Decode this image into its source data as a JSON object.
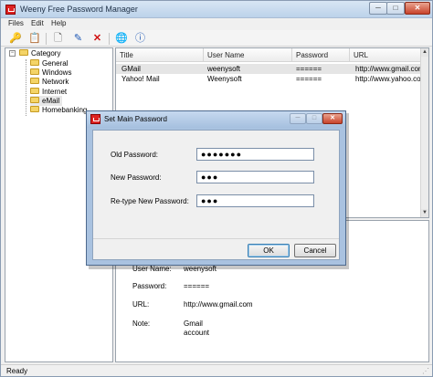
{
  "window": {
    "title": "Weeny Free Password Manager",
    "min_glyph": "─",
    "max_glyph": "□",
    "close_glyph": "✕"
  },
  "menu": [
    "Files",
    "Edit",
    "Help"
  ],
  "toolbar": {
    "icons": [
      "key-icon",
      "clipboard-icon",
      "new-document-icon",
      "edit-icon",
      "delete-icon",
      "globe-icon",
      "info-icon"
    ],
    "glyphs": [
      "🔑",
      "📋",
      "🗋",
      "✎",
      "✕",
      "🌐",
      "ⓘ"
    ]
  },
  "tree": {
    "expander": "−",
    "root": "Category",
    "children": [
      "General",
      "Windows",
      "Network",
      "Internet",
      "eMail",
      "Homebanking"
    ],
    "selected": "eMail"
  },
  "list": {
    "columns": [
      "Title",
      "User Name",
      "Password",
      "URL"
    ],
    "rows": [
      {
        "title": "GMail",
        "user": "weenysoft",
        "password": "======",
        "url": "http://www.gmail.com"
      },
      {
        "title": "Yahoo! Mail",
        "user": "Weenysoft",
        "password": "======",
        "url": "http://www.yahoo.com"
      }
    ],
    "scroll_up": "▲",
    "scroll_down": "▼"
  },
  "detail": {
    "user_label": "User Name:",
    "user_value": "weenysoft",
    "password_label": "Password:",
    "password_value": "======",
    "url_label": "URL:",
    "url_value": "http://www.gmail.com",
    "note_label": "Note:",
    "note_value_line1": "Gmail",
    "note_value_line2": "account"
  },
  "status": {
    "text": "Ready",
    "grip": "⋰"
  },
  "dialog": {
    "title": "Set Main Password",
    "old_label": "Old Password:",
    "old_value": "●●●●●●●",
    "new_label": "New Password:",
    "new_value": "●●●",
    "retype_label": "Re-type New Password:",
    "retype_value": "●●●",
    "ok_label": "OK",
    "cancel_label": "Cancel",
    "min_glyph": "─",
    "max_glyph": "□",
    "close_glyph": "✕"
  },
  "colors": {
    "titlebar": "#c9dcef",
    "dialog_frame": "#a9c2e0",
    "selection": "#e5e5e5",
    "close_button": "#c8432b"
  }
}
